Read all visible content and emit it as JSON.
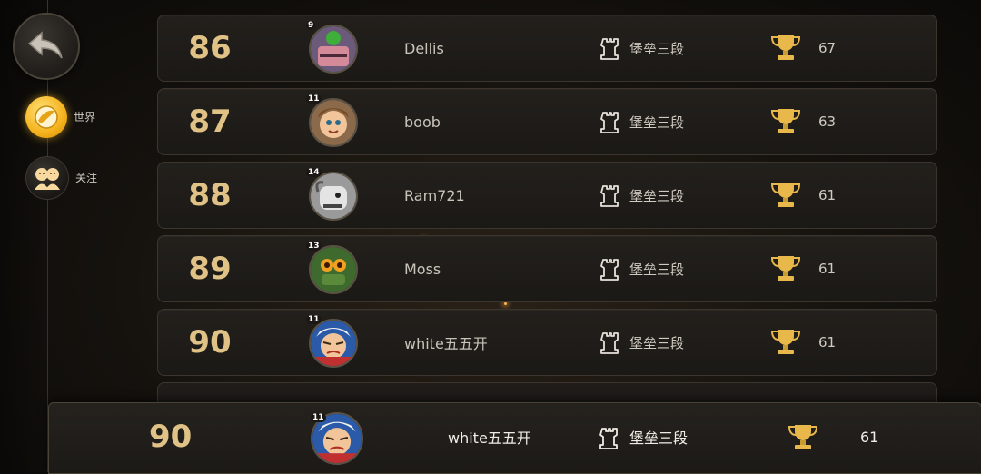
{
  "sidebar": {
    "back_icon": "back-arrow-icon",
    "tabs": [
      {
        "label": "世界",
        "icon": "globe-icon",
        "active": true
      },
      {
        "label": "关注",
        "icon": "friends-icon",
        "active": false
      }
    ]
  },
  "rows": [
    {
      "rank": "86",
      "level": "9",
      "name": "Dellis",
      "tier": "堡垒三段",
      "cups": "67"
    },
    {
      "rank": "87",
      "level": "11",
      "name": "boob",
      "tier": "堡垒三段",
      "cups": "63"
    },
    {
      "rank": "88",
      "level": "14",
      "name": "Ram721",
      "tier": "堡垒三段",
      "cups": "61"
    },
    {
      "rank": "89",
      "level": "13",
      "name": "Moss",
      "tier": "堡垒三段",
      "cups": "61"
    },
    {
      "rank": "90",
      "level": "11",
      "name": "white五五开",
      "tier": "堡垒三段",
      "cups": "61"
    }
  ],
  "my_row": {
    "rank": "90",
    "level": "11",
    "name": "white五五开",
    "tier": "堡垒三段",
    "cups": "61"
  },
  "colors": {
    "rank_gold": "#e0c286",
    "accent": "#f5b21c"
  }
}
